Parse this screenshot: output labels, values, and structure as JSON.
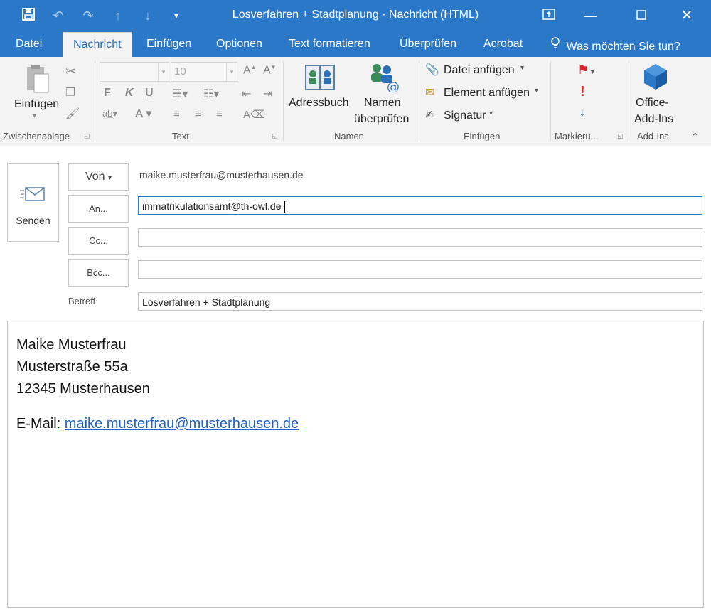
{
  "window": {
    "title": "Losverfahren + Stadtplanung - Nachricht (HTML)"
  },
  "menu": {
    "tabs": [
      "Datei",
      "Nachricht",
      "Einfügen",
      "Optionen",
      "Text formatieren",
      "Überprüfen",
      "Acrobat"
    ],
    "tell_me": "Was möchten Sie tun?"
  },
  "ribbon": {
    "clipboard": {
      "paste_label": "Einfügen",
      "group_label": "Zwischenablage"
    },
    "text": {
      "font_size": "10",
      "group_label": "Text"
    },
    "names": {
      "addressbook_label": "Adressbuch",
      "check_names_label_1": "Namen",
      "check_names_label_2": "überprüfen",
      "group_label": "Namen"
    },
    "insert": {
      "attach_file": "Datei anfügen",
      "attach_item": "Element anfügen",
      "signature": "Signatur",
      "group_label": "Einfügen"
    },
    "tags": {
      "group_label": "Markieru..."
    },
    "addins": {
      "label_1": "Office-",
      "label_2": "Add-Ins",
      "group_label": "Add-Ins"
    }
  },
  "compose": {
    "send_label": "Senden",
    "from_label": "Von",
    "from_value": "maike.musterfrau@musterhausen.de",
    "to_label": "An...",
    "to_value": "immatrikulationsamt@th-owl.de",
    "cc_label": "Cc...",
    "cc_value": "",
    "bcc_label": "Bcc...",
    "bcc_value": "",
    "subject_label": "Betreff",
    "subject_value": "Losverfahren + Stadtplanung"
  },
  "body": {
    "name": "Maike Musterfrau",
    "street": "Musterstraße 55a",
    "city": "12345 Musterhausen",
    "email_prefix": "E-Mail: ",
    "email_link": "maike.musterfrau@musterhausen.de"
  },
  "colors": {
    "accent": "#2b78c8",
    "ribbon_bg": "#f3f3f3",
    "link": "#1f5fc7"
  }
}
